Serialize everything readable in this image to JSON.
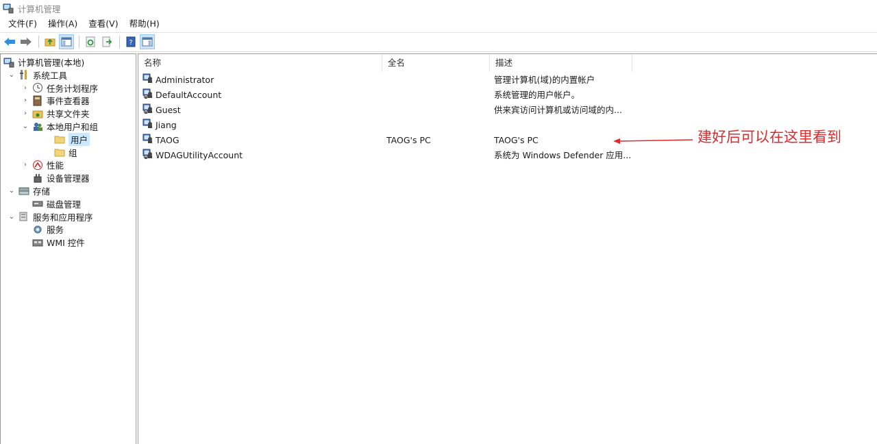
{
  "window": {
    "title": "计算机管理"
  },
  "menu": [
    "文件(F)",
    "操作(A)",
    "查看(V)",
    "帮助(H)"
  ],
  "tree": [
    {
      "label": "计算机管理(本地)",
      "icon": "computer-management-icon",
      "level": 0,
      "expand": ""
    },
    {
      "label": "系统工具",
      "icon": "tools-icon",
      "level": 1,
      "expand": "expanded"
    },
    {
      "label": "任务计划程序",
      "icon": "clock-icon",
      "level": 2,
      "expand": "collapsed"
    },
    {
      "label": "事件查看器",
      "icon": "event-viewer-icon",
      "level": 2,
      "expand": "collapsed"
    },
    {
      "label": "共享文件夹",
      "icon": "shared-folder-icon",
      "level": 2,
      "expand": "collapsed"
    },
    {
      "label": "本地用户和组",
      "icon": "users-group-icon",
      "level": 2,
      "expand": "expanded"
    },
    {
      "label": "用户",
      "icon": "folder-icon",
      "level": 3,
      "expand": "",
      "selected": true
    },
    {
      "label": "组",
      "icon": "folder-icon",
      "level": 3,
      "expand": ""
    },
    {
      "label": "性能",
      "icon": "performance-icon",
      "level": 2,
      "expand": "collapsed"
    },
    {
      "label": "设备管理器",
      "icon": "device-manager-icon",
      "level": 2,
      "expand": ""
    },
    {
      "label": "存储",
      "icon": "storage-icon",
      "level": 1,
      "expand": "expanded"
    },
    {
      "label": "磁盘管理",
      "icon": "disk-icon",
      "level": 2,
      "expand": ""
    },
    {
      "label": "服务和应用程序",
      "icon": "services-apps-icon",
      "level": 1,
      "expand": "expanded"
    },
    {
      "label": "服务",
      "icon": "gear-icon",
      "level": 2,
      "expand": ""
    },
    {
      "label": "WMI 控件",
      "icon": "wmi-icon",
      "level": 2,
      "expand": ""
    }
  ],
  "columns": [
    "名称",
    "全名",
    "描述"
  ],
  "users": [
    {
      "name": "Administrator",
      "full": "",
      "desc": "管理计算机(域)的内置帐户",
      "disabled": false
    },
    {
      "name": "DefaultAccount",
      "full": "",
      "desc": "系统管理的用户帐户。",
      "disabled": true
    },
    {
      "name": "Guest",
      "full": "",
      "desc": "供来宾访问计算机或访问域的内...",
      "disabled": true
    },
    {
      "name": "Jiang",
      "full": "",
      "desc": "",
      "disabled": false
    },
    {
      "name": "TAOG",
      "full": "TAOG's PC",
      "desc": "TAOG's PC",
      "disabled": false
    },
    {
      "name": "WDAGUtilityAccount",
      "full": "",
      "desc": "系统为 Windows Defender 应用...",
      "disabled": true
    }
  ],
  "annotation": {
    "text": "建好后可以在这里看到",
    "color": "#e0292b"
  },
  "colors": {
    "selection": "#cce8ff",
    "accent": "#3a7fd5"
  }
}
